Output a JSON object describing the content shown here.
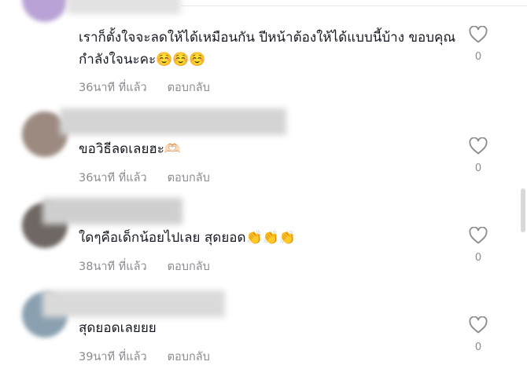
{
  "colors": {
    "text": "#161823",
    "muted": "#8a8b91"
  },
  "comments": [
    {
      "text": "เราก็ตั้งใจจะลดให้ได้เหมือนกัน ปีหน้าต้องให้ได้แบบนี้บ้าง ขอบคุณกำลังใจนะคะ☺️☺️☺️",
      "time": "36นาที ที่แล้ว",
      "reply": "ตอบกลับ",
      "likes": "0",
      "icon": "heart-outline-icon"
    },
    {
      "text": "ขอวิธีลดเลยฮะ🫶🏻",
      "time": "36นาที ที่แล้ว",
      "reply": "ตอบกลับ",
      "likes": "0",
      "icon": "heart-outline-icon"
    },
    {
      "text": "ใดๆคือเด็กน้อยไปเลย สุดยอด👏👏👏",
      "time": "38นาที ที่แล้ว",
      "reply": "ตอบกลับ",
      "likes": "0",
      "icon": "heart-outline-icon"
    },
    {
      "text": "สุดยอดเลยยย",
      "time": "39นาที ที่แล้ว",
      "reply": "ตอบกลับ",
      "likes": "0",
      "icon": "heart-outline-icon"
    }
  ]
}
